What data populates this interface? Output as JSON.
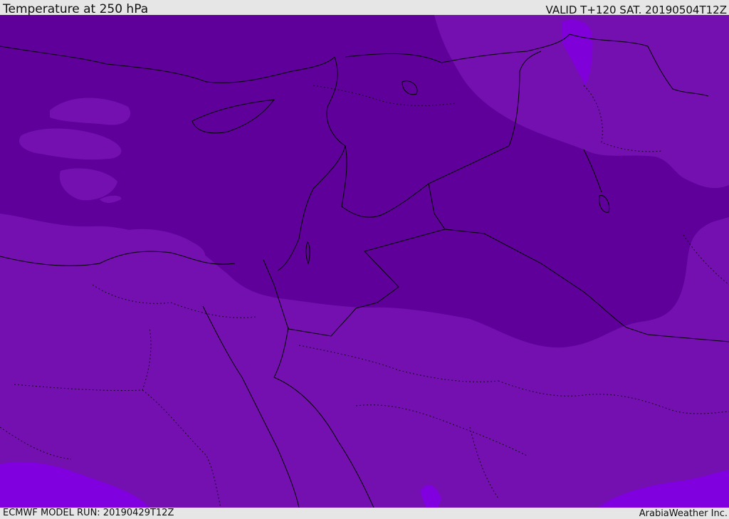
{
  "header": {
    "title": "Temperature at 250 hPa",
    "valid_time": "VALID T+120 SAT. 20190504T12Z"
  },
  "footer": {
    "model_run": "ECMWF MODEL RUN: 20190429T12Z",
    "credit": "ArabiaWeather Inc."
  },
  "map": {
    "field": "temperature-250hPa",
    "colors": {
      "coldest": "#5f009a",
      "cold": "#7010b0",
      "mild": "#7a14b6",
      "warm": "#8000e0",
      "border": "#000000"
    }
  }
}
